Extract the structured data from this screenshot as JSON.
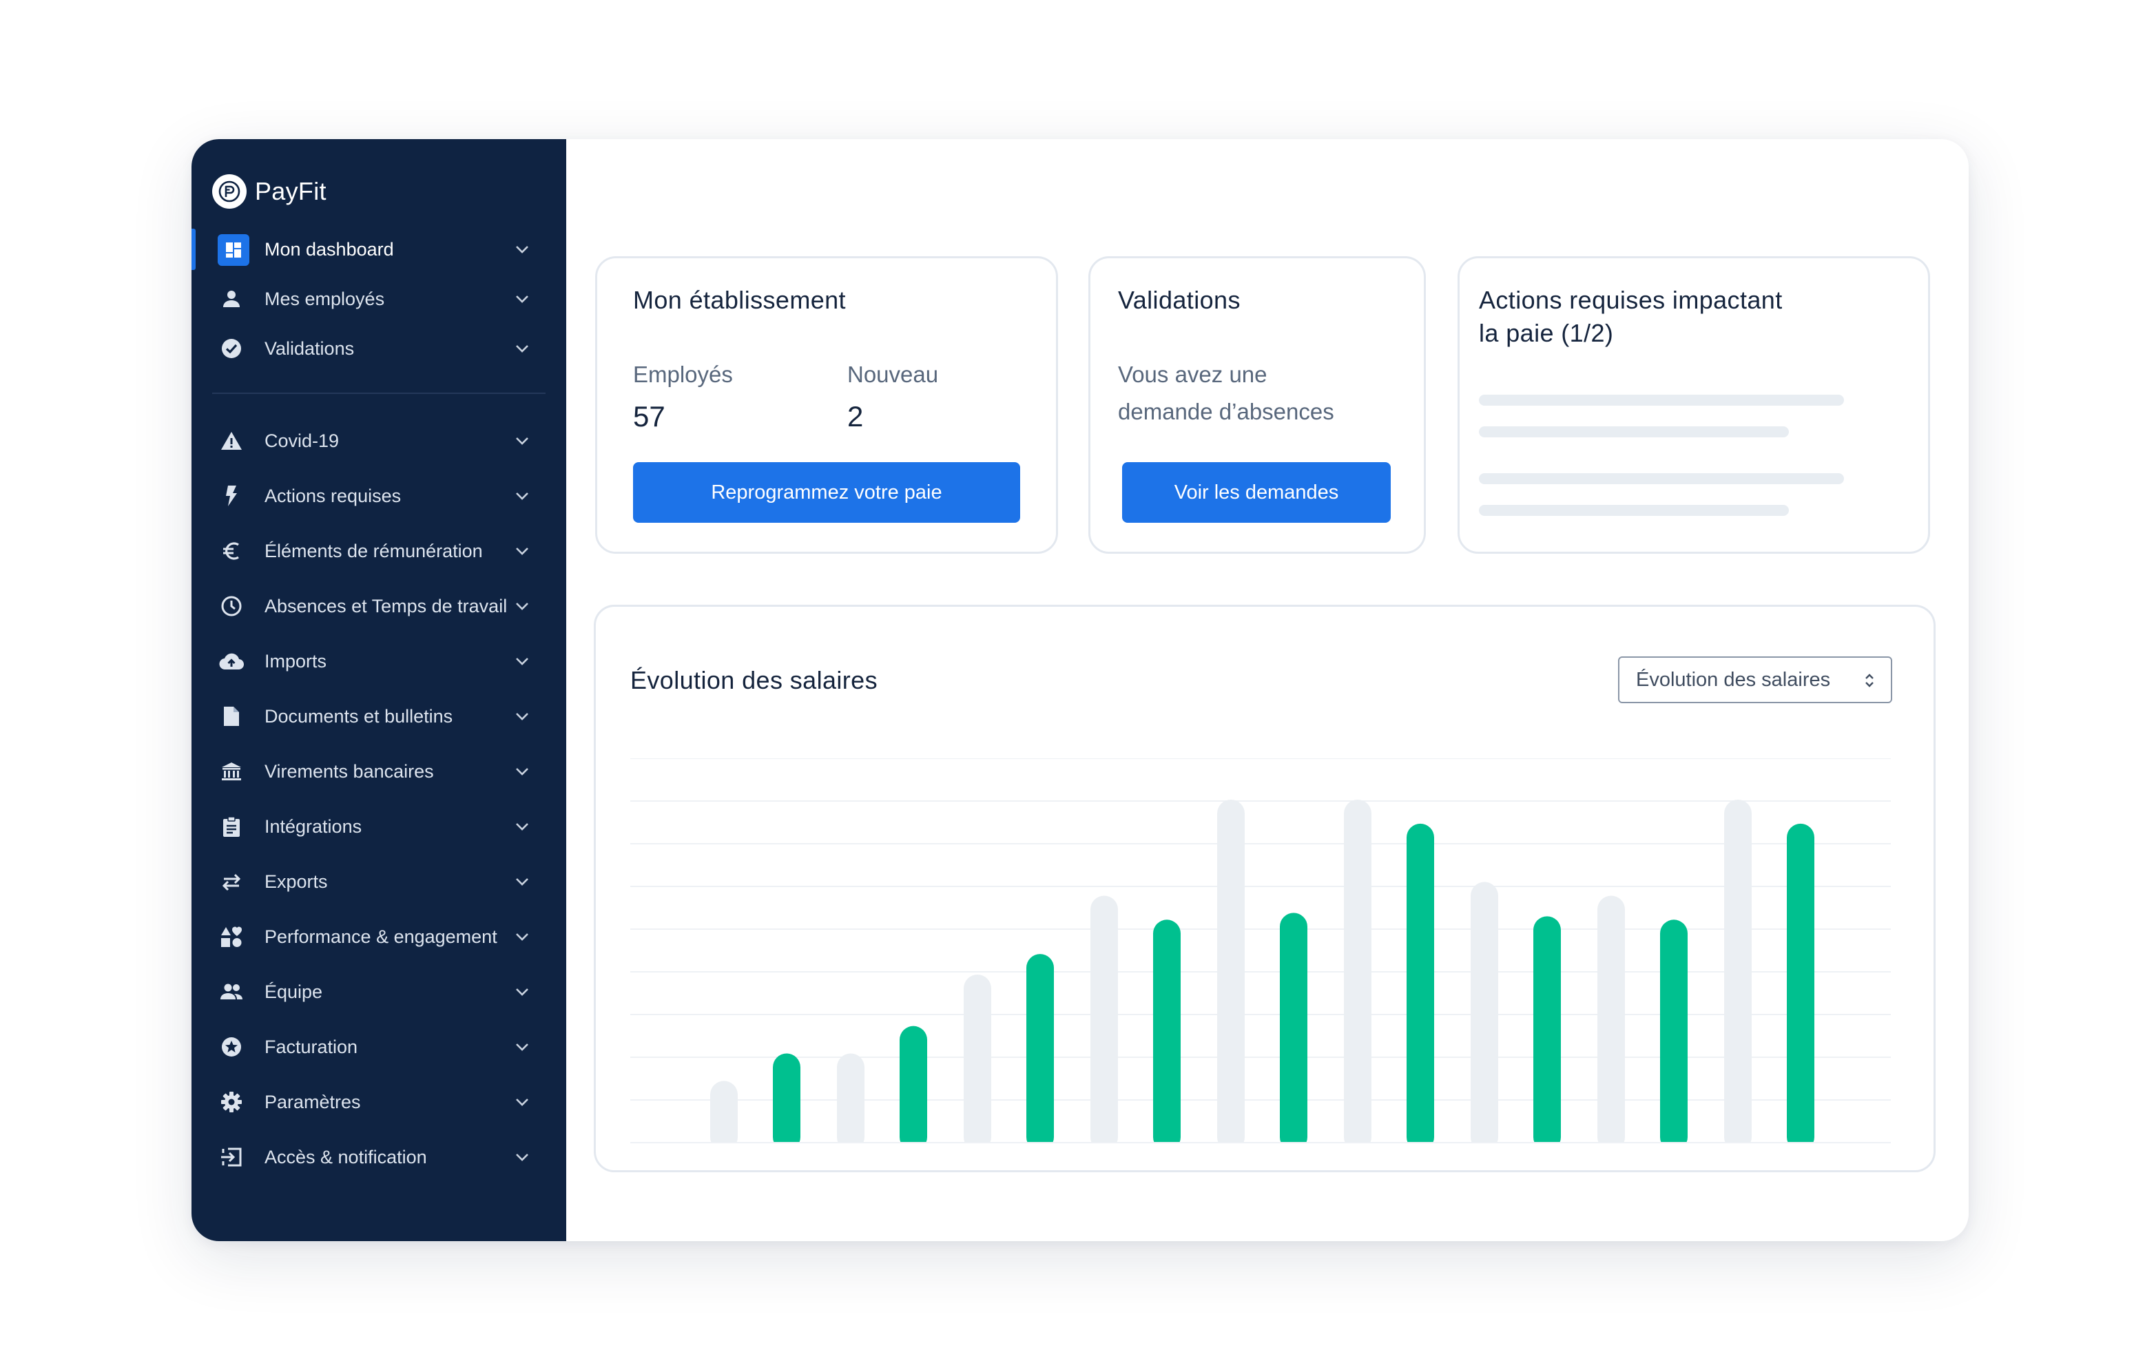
{
  "brand": {
    "name": "PayFit"
  },
  "sidebar": {
    "items": [
      {
        "label": "Mon dashboard",
        "icon": "dashboard-icon",
        "active": true
      },
      {
        "label": "Mes employés",
        "icon": "person-icon"
      },
      {
        "label": "Validations",
        "icon": "check-circle-icon"
      },
      {
        "label": "Covid-19",
        "icon": "warning-icon"
      },
      {
        "label": "Actions requises",
        "icon": "lightning-icon"
      },
      {
        "label": "Éléments de rémunération",
        "icon": "euro-icon"
      },
      {
        "label": "Absences et Temps de travail",
        "icon": "clock-icon"
      },
      {
        "label": "Imports",
        "icon": "cloud-upload-icon"
      },
      {
        "label": "Documents et bulletins",
        "icon": "document-icon"
      },
      {
        "label": "Virements bancaires",
        "icon": "bank-icon"
      },
      {
        "label": "Intégrations",
        "icon": "clipboard-icon"
      },
      {
        "label": "Exports",
        "icon": "swap-arrows-icon"
      },
      {
        "label": "Performance & engagement",
        "icon": "shapes-icon"
      },
      {
        "label": "Équipe",
        "icon": "group-icon"
      },
      {
        "label": "Facturation",
        "icon": "star-badge-icon"
      },
      {
        "label": "Paramètres",
        "icon": "gear-icon"
      },
      {
        "label": "Accès & notification",
        "icon": "login-icon"
      }
    ]
  },
  "etablissement": {
    "title": "Mon établissement",
    "employees_label": "Employés",
    "employees_value": "57",
    "new_label": "Nouveau",
    "new_value": "2",
    "button": "Reprogrammez votre paie"
  },
  "validations": {
    "title": "Validations",
    "message_line1": "Vous avez une",
    "message_line2": "demande d’absences",
    "button": "Voir les demandes"
  },
  "actions": {
    "title_line1": "Actions requises impactant",
    "title_line2": "la paie (1/2)"
  },
  "salaires": {
    "title": "Évolution des salaires",
    "select_value": "Évolution des salaires"
  },
  "colors": {
    "sidebar_bg": "#0f2342",
    "accent": "#1d73e8",
    "bar_primary": "#00c08f",
    "bar_secondary": "#ebeff3"
  },
  "chart_data": {
    "type": "bar",
    "ylim": [
      0,
      100
    ],
    "grid": true,
    "series": [
      {
        "color": "#ebeff3",
        "values": [
          18,
          26,
          49,
          72,
          100,
          100,
          76,
          72,
          100
        ]
      },
      {
        "color": "#00c08f",
        "values": [
          26,
          34,
          55,
          65,
          67,
          93,
          66,
          65,
          93
        ]
      }
    ]
  }
}
